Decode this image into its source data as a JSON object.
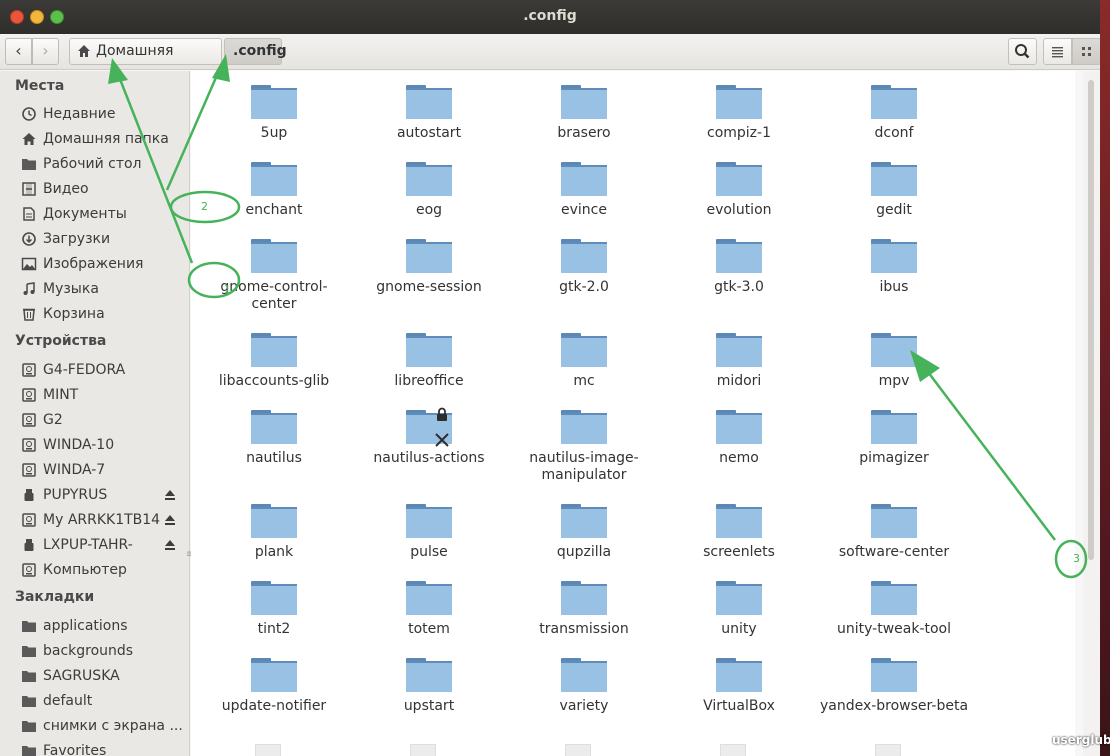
{
  "window": {
    "title": ".config"
  },
  "toolbar": {
    "breadcrumbs": [
      {
        "label": "Домашняя папка",
        "icon": "home-icon"
      },
      {
        "label": ".config",
        "current": true
      }
    ]
  },
  "sidebar": {
    "places_heading": "Места",
    "places": [
      {
        "label": "Недавние",
        "icon": "clock-icon"
      },
      {
        "label": "Домашняя папка",
        "icon": "home-icon"
      },
      {
        "label": "Рабочий стол",
        "icon": "folder-icon"
      },
      {
        "label": "Видео",
        "icon": "film-icon"
      },
      {
        "label": "Документы",
        "icon": "document-icon"
      },
      {
        "label": "Загрузки",
        "icon": "download-icon"
      },
      {
        "label": "Изображения",
        "icon": "image-icon"
      },
      {
        "label": "Музыка",
        "icon": "music-icon"
      },
      {
        "label": "Корзина",
        "icon": "trash-icon"
      }
    ],
    "devices_heading": "Устройства",
    "devices": [
      {
        "label": "G4-FEDORA",
        "icon": "drive-icon"
      },
      {
        "label": "MINT",
        "icon": "drive-icon"
      },
      {
        "label": "G2",
        "icon": "drive-icon"
      },
      {
        "label": "WINDA-10",
        "icon": "drive-icon"
      },
      {
        "label": "WINDA-7",
        "icon": "drive-icon"
      },
      {
        "label": "PUPYRUS",
        "icon": "usb-icon",
        "eject": true
      },
      {
        "label": "My ARRKK1TB14",
        "icon": "drive-icon",
        "eject": true
      },
      {
        "label": "LXPUP-TAHR-",
        "icon": "usb-icon",
        "eject": true
      },
      {
        "label": "Компьютер",
        "icon": "drive-icon"
      }
    ],
    "bookmarks_heading": "Закладки",
    "bookmarks": [
      {
        "label": "applications",
        "icon": "folder-icon"
      },
      {
        "label": "backgrounds",
        "icon": "folder-icon"
      },
      {
        "label": "SAGRUSKA",
        "icon": "folder-icon"
      },
      {
        "label": "default",
        "icon": "folder-icon"
      },
      {
        "label": "снимки с экрана ...",
        "icon": "folder-icon"
      },
      {
        "label": "Favorites",
        "icon": "folder-icon"
      }
    ]
  },
  "files": [
    [
      "5up",
      "autostart",
      "brasero",
      "compiz-1",
      "dconf"
    ],
    [
      "enchant",
      "eog",
      "evince",
      "evolution",
      "gedit"
    ],
    [
      "gnome-control-center",
      "gnome-session",
      "gtk-2.0",
      "gtk-3.0",
      "ibus"
    ],
    [
      "libaccounts-glib",
      "libreoffice",
      "mc",
      "midori",
      "mpv"
    ],
    [
      "nautilus",
      "nautilus-actions",
      "nautilus-image-manipulator",
      "nemo",
      "pimagizer"
    ],
    [
      "plank",
      "pulse",
      "qupzilla",
      "screenlets",
      "software-center"
    ],
    [
      "tint2",
      "totem",
      "transmission",
      "unity",
      "unity-tweak-tool"
    ],
    [
      "update-notifier",
      "upstart",
      "variety",
      "VirtualBox",
      "yandex-browser-beta"
    ]
  ],
  "emblems": {
    "nautilus-actions": [
      "lock-icon",
      "x-icon"
    ]
  },
  "annotations": [
    "1",
    "2",
    "3"
  ],
  "watermark": "userglub",
  "colors": {
    "folder": "#99c1e4",
    "folder_dark": "#5b88b5",
    "annotation": "#46b35a"
  }
}
